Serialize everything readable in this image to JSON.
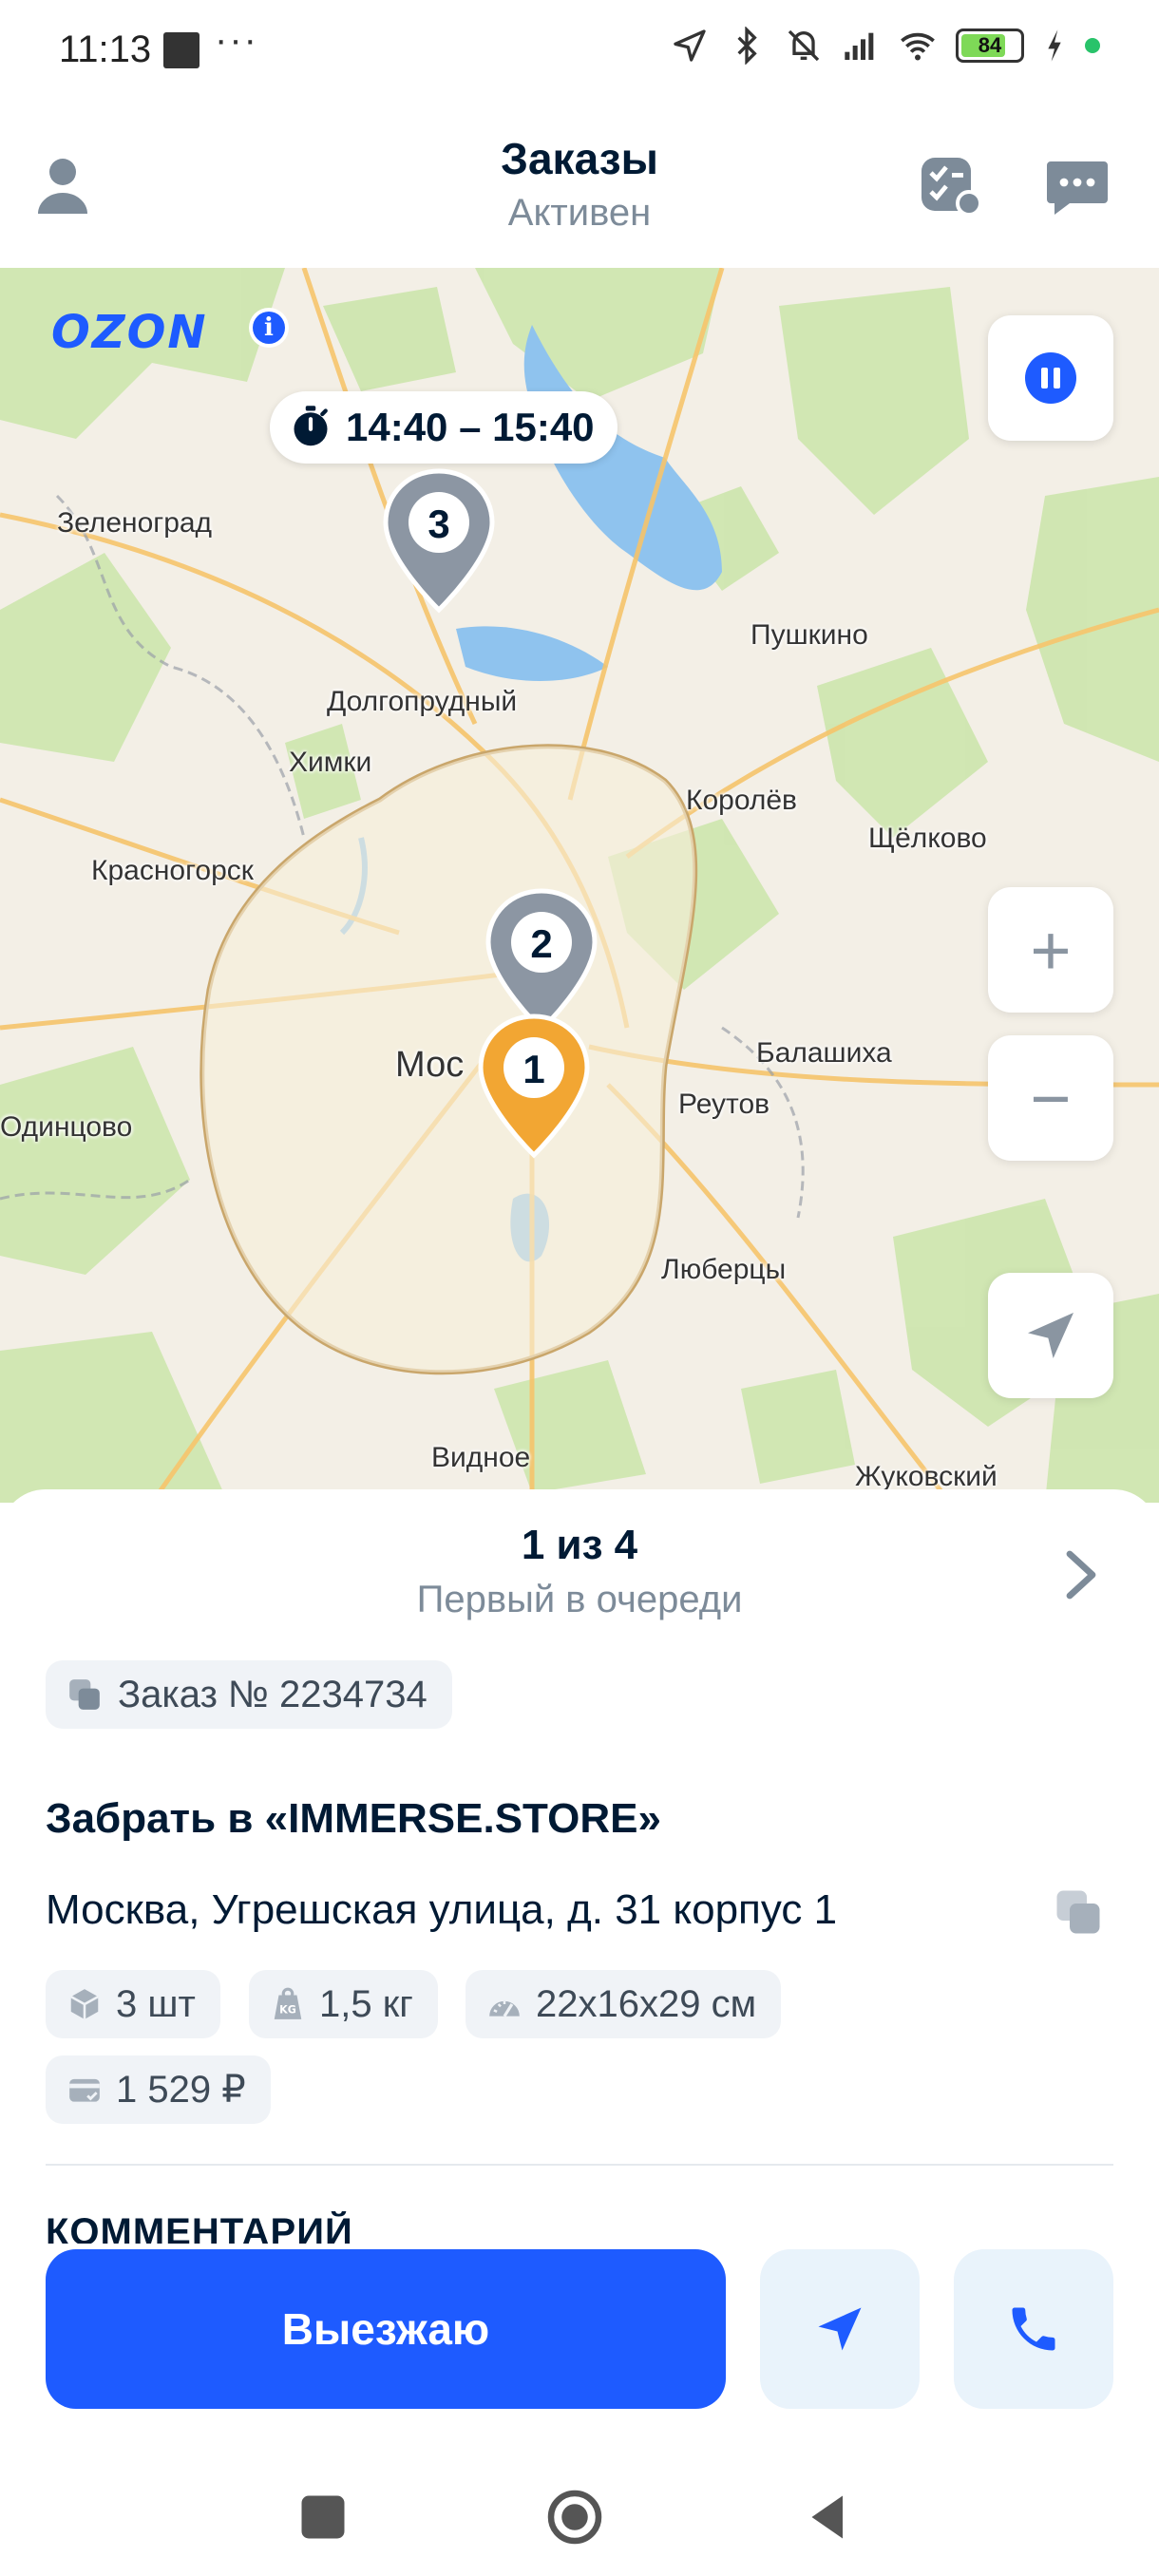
{
  "status_bar": {
    "time": "11:13",
    "dots": "···",
    "battery": "84",
    "icons": [
      "notification-square-icon",
      "location-arrow-icon",
      "bluetooth-icon",
      "mute-icon",
      "signal-icon",
      "wifi-icon",
      "battery-icon",
      "charging-icon"
    ]
  },
  "header": {
    "title": "Заказы",
    "subtitle": "Активен",
    "icons": [
      "profile-icon",
      "checklist-icon",
      "chat-icon"
    ]
  },
  "map": {
    "logo": "OZON",
    "info": "i",
    "time_window": "14:40 – 15:40",
    "labels": {
      "zelenograd": "Зеленоград",
      "pushkino": "Пушкино",
      "dolgoprudny": "Долгопрудный",
      "khimki": "Химки",
      "korolev": "Королёв",
      "shchelkovo": "Щёлково",
      "krasnogorsk": "Красногорск",
      "balashikha": "Балашиха",
      "moscow": "Мос",
      "reutov": "Реутов",
      "odintsovo": "Одинцово",
      "lyubertsy": "Люберцы",
      "vidnoe": "Видное",
      "zhukovsky": "Жуковский"
    },
    "pins": [
      {
        "number": "1",
        "color": "#f2a633"
      },
      {
        "number": "2",
        "color": "#8c96a3"
      },
      {
        "number": "3",
        "color": "#8c96a3"
      }
    ],
    "zoom_in": "+",
    "zoom_out": "−"
  },
  "sheet": {
    "queue_position": "1 из 4",
    "queue_status": "Первый в очереди",
    "order_number": "Заказ № 2234734",
    "pickup_title": "Забрать в «IMMERSE.STORE»",
    "address": "Москва, Угрешская улица, д. 31 корпус 1",
    "chips": {
      "quantity": "3 шт",
      "weight": "1,5 кг",
      "dimensions": "22х16х29 см",
      "price": "1 529 ₽"
    },
    "comment_heading": "КОММЕНТАРИЙ",
    "primary_button": "Выезжаю"
  },
  "colors": {
    "accent": "#1e5bff",
    "pin_active": "#f2a633",
    "pin_inactive": "#8c96a3",
    "secondary_text": "#7d8b99"
  }
}
